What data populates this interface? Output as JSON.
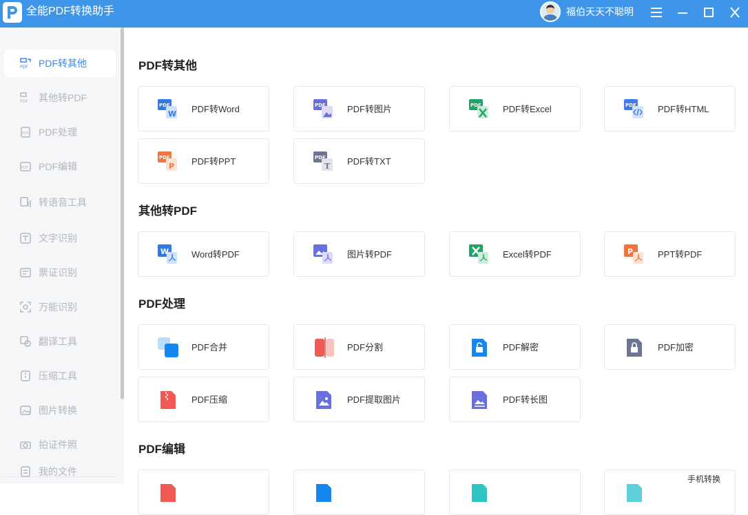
{
  "titlebar": {
    "app_title": "全能PDF转换助手",
    "username": "福伯天天不聪明",
    "icons": [
      "menu-icon",
      "minimize-icon",
      "maximize-icon",
      "close-icon"
    ]
  },
  "sidebar": {
    "items": [
      {
        "label": "PDF转其他",
        "active": true
      },
      {
        "label": "其他转PDF"
      },
      {
        "label": "PDF处理"
      },
      {
        "label": "PDF编辑"
      },
      {
        "label": "转语音工具"
      },
      {
        "label": "文字识别"
      },
      {
        "label": "票证识别"
      },
      {
        "label": "万能识别"
      },
      {
        "label": "翻译工具"
      },
      {
        "label": "压缩工具"
      },
      {
        "label": "图片转换"
      },
      {
        "label": "拍证件照"
      }
    ],
    "my_files": "我的文件"
  },
  "sections": [
    {
      "title": "PDF转其他",
      "cards": [
        "PDF转Word",
        "PDF转图片",
        "PDF转Excel",
        "PDF转HTML",
        "PDF转PPT",
        "PDF转TXT"
      ]
    },
    {
      "title": "其他转PDF",
      "cards": [
        "Word转PDF",
        "图片转PDF",
        "Excel转PDF",
        "PPT转PDF"
      ]
    },
    {
      "title": "PDF处理",
      "cards": [
        "PDF合并",
        "PDF分割",
        "PDF解密",
        "PDF加密",
        "PDF压缩",
        "PDF提取图片",
        "PDF转长图"
      ]
    },
    {
      "title": "PDF编辑",
      "extra_text": "手机转换"
    }
  ],
  "colors": {
    "titlebar": "#3e95ea",
    "accent": "#3e86e8",
    "word": "#2f7ae5",
    "excel": "#21a366",
    "ppt": "#f0743b",
    "image": "#6a6fe0",
    "red": "#ef5a55"
  }
}
